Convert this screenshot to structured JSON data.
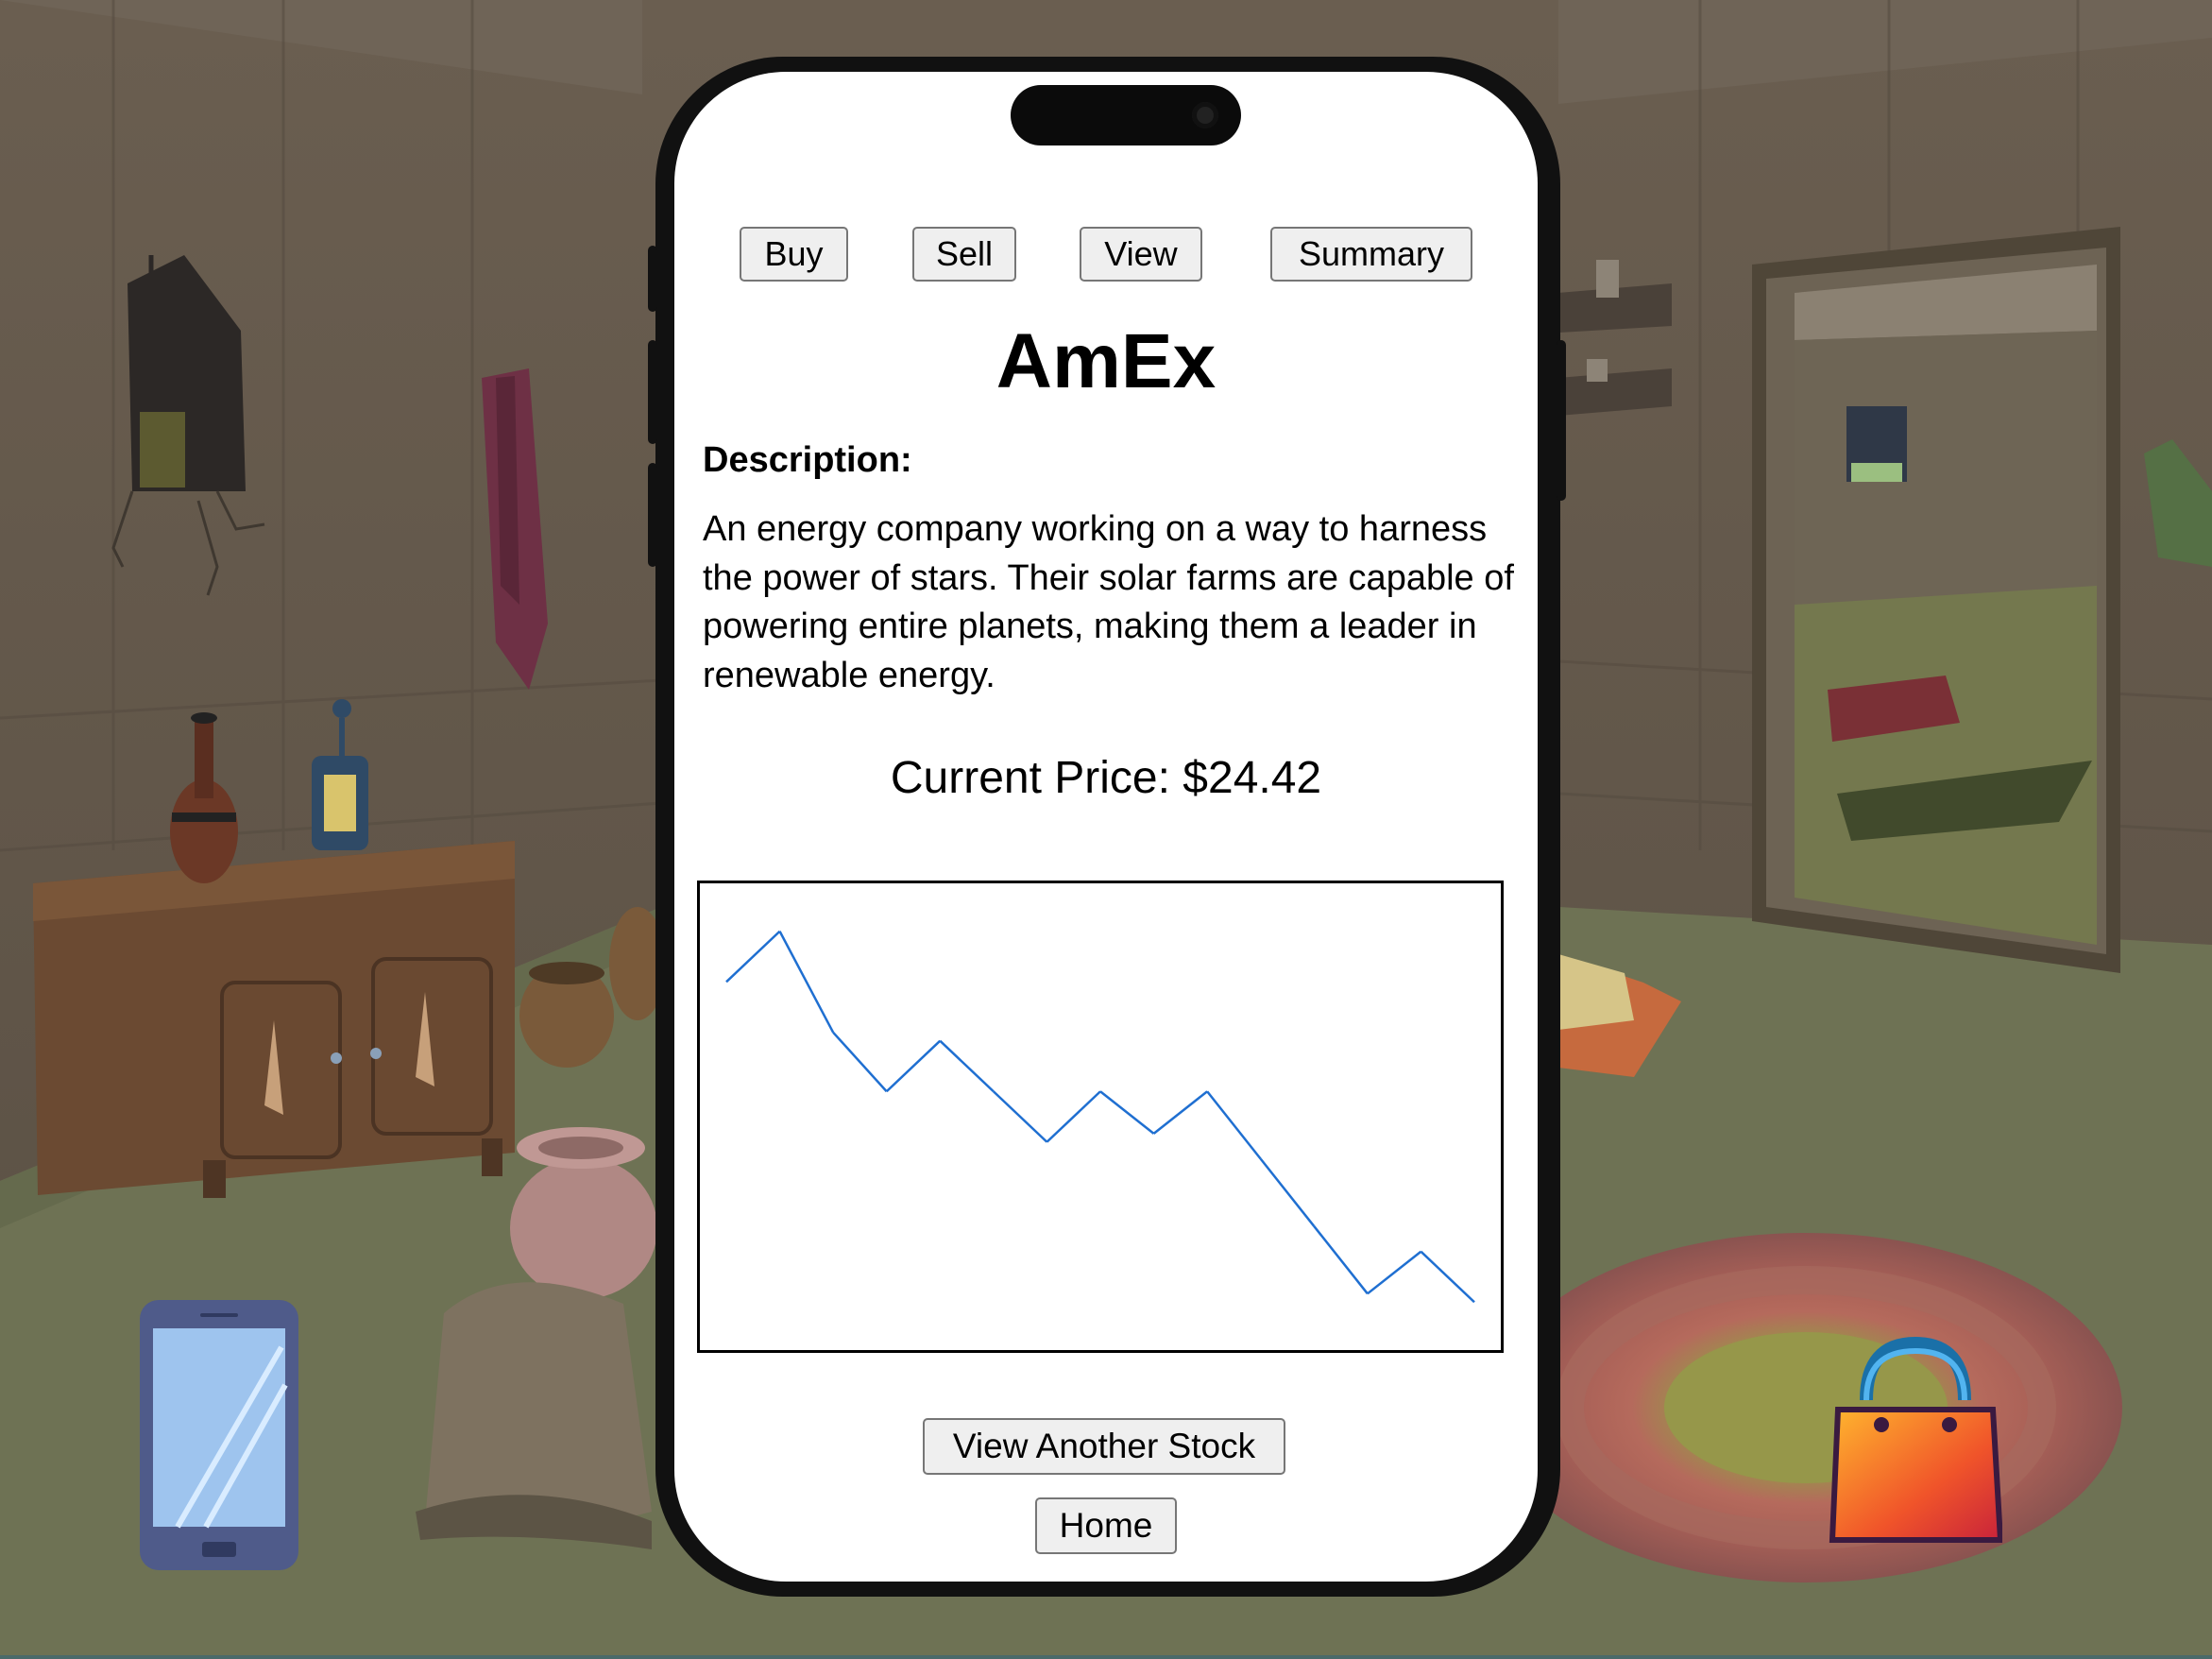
{
  "phone": {
    "tabs": [
      {
        "label": "Buy"
      },
      {
        "label": "Sell"
      },
      {
        "label": "View"
      },
      {
        "label": "Summary"
      }
    ],
    "stock_name": "AmEx",
    "description_label": "Description:",
    "description_text": "An energy company working on a way to harness the power of stars. Their solar farms are capable of powering entire planets, making them a leader in renewable energy.",
    "price_text": "Current Price: $24.42",
    "view_another_label": "View Another Stock",
    "home_label": "Home"
  },
  "scene_icons": {
    "phone_icon": "phone-icon",
    "shop_icon": "shopping-bag-icon"
  },
  "colors": {
    "line": "#1f6fd1",
    "background_wall": "#62584a",
    "floor": "#6e7254"
  },
  "chart_data": {
    "type": "line",
    "title": "",
    "xlabel": "",
    "ylabel": "",
    "x": [
      0,
      1,
      2,
      3,
      4,
      5,
      6,
      7,
      8,
      9,
      10,
      11,
      12,
      13,
      14
    ],
    "values": [
      0.82,
      0.94,
      0.7,
      0.56,
      0.68,
      0.56,
      0.44,
      0.56,
      0.46,
      0.56,
      0.4,
      0.24,
      0.08,
      0.18,
      0.06
    ],
    "ylim": [
      0,
      1
    ],
    "grid": false
  }
}
